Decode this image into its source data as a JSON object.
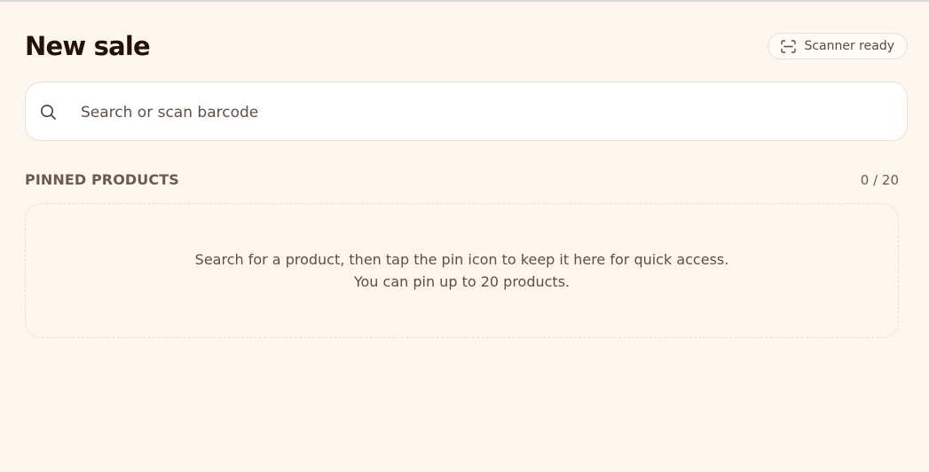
{
  "header": {
    "title": "New sale",
    "scanner_status": "Scanner ready"
  },
  "icons": {
    "scanner": "scanner-icon",
    "search": "search-icon"
  },
  "search": {
    "value": "",
    "placeholder": "Search or scan barcode"
  },
  "pinned": {
    "title": "PINNED PRODUCTS",
    "count": "0 / 20",
    "empty_line_1": "Search for a product, then tap the pin icon to keep it here for quick access.",
    "empty_line_2": "You can pin up to 20 products."
  }
}
